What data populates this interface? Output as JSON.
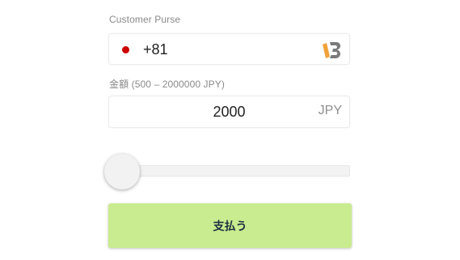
{
  "purse": {
    "label": "Customer Purse",
    "dial_code": "+81",
    "flag_icon": "japan-flag-icon",
    "flag_color": "#cc0000",
    "logo_icon": "brand-b-logo-icon",
    "logo_colors": {
      "accent": "#f0a23a",
      "main": "#7a7a7a"
    }
  },
  "amount": {
    "label": "金額 (500 – 2000000 JPY)",
    "value": "2000",
    "currency": "JPY",
    "min": 500,
    "max": 2000000
  },
  "slider": {
    "value": 2000,
    "fraction": 0.00075
  },
  "pay_button": {
    "label": "支払う",
    "color": "#c8ec8f"
  }
}
